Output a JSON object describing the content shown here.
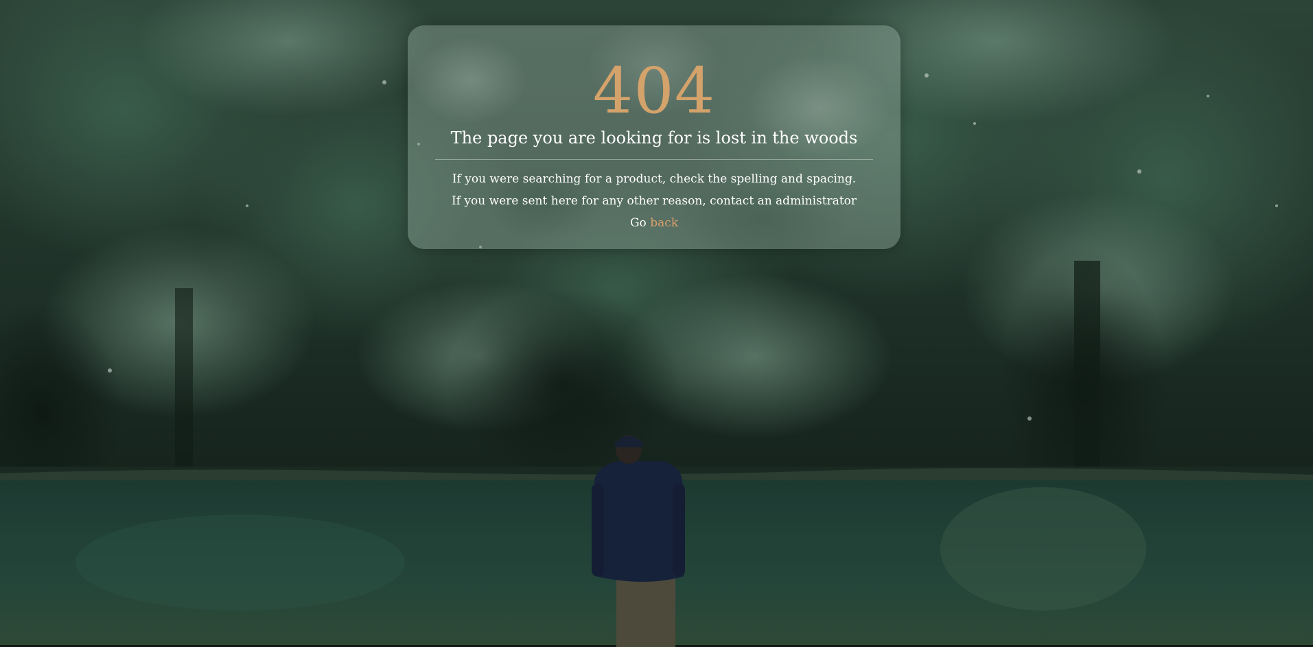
{
  "error": {
    "code": "404",
    "headline": "The page you are looking for is lost in the woods",
    "message_line1": "If you were searching for a product, check the spelling and spacing.",
    "message_line2": "If you were sent here for any other reason, contact an administrator",
    "go_prefix": "Go",
    "back_link_label": "back"
  },
  "colors": {
    "accent": "#d4a26b",
    "text": "#ffffff",
    "card_tint": "#96afa2"
  },
  "background": {
    "scene": "forest-lake-with-person"
  }
}
